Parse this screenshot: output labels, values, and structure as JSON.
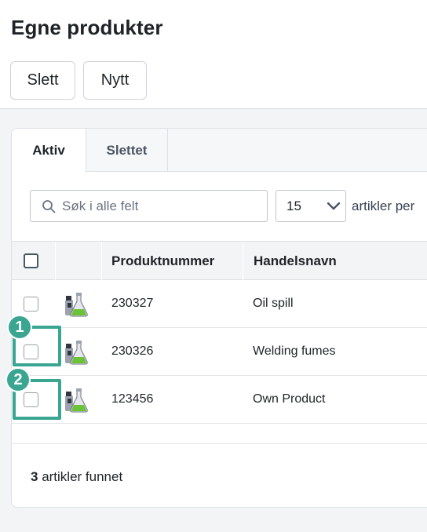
{
  "header": {
    "title": "Egne produkter",
    "delete_label": "Slett",
    "new_label": "Nytt"
  },
  "tabs": [
    {
      "label": "Aktiv",
      "active": true
    },
    {
      "label": "Slettet",
      "active": false
    }
  ],
  "toolbar": {
    "search_placeholder": "Søk i alle felt",
    "search_value": "",
    "page_size": "15",
    "per_page_label": "artikler per"
  },
  "table": {
    "columns": [
      "",
      "",
      "Produktnummer",
      "Handelsnavn"
    ],
    "rows": [
      {
        "product_number": "230327",
        "trade_name": "Oil spill",
        "icon": "chemical-product-icon"
      },
      {
        "product_number": "230326",
        "trade_name": "Welding fumes",
        "icon": "chemical-product-icon"
      },
      {
        "product_number": "123456",
        "trade_name": "Own Product",
        "icon": "chemical-product-icon"
      }
    ]
  },
  "footer": {
    "count": "3",
    "count_label": " artikler funnet"
  },
  "annotations": [
    {
      "number": "1"
    },
    {
      "number": "2"
    }
  ],
  "colors": {
    "annotation": "#3aa691",
    "flask_green": "#6cc33a"
  }
}
